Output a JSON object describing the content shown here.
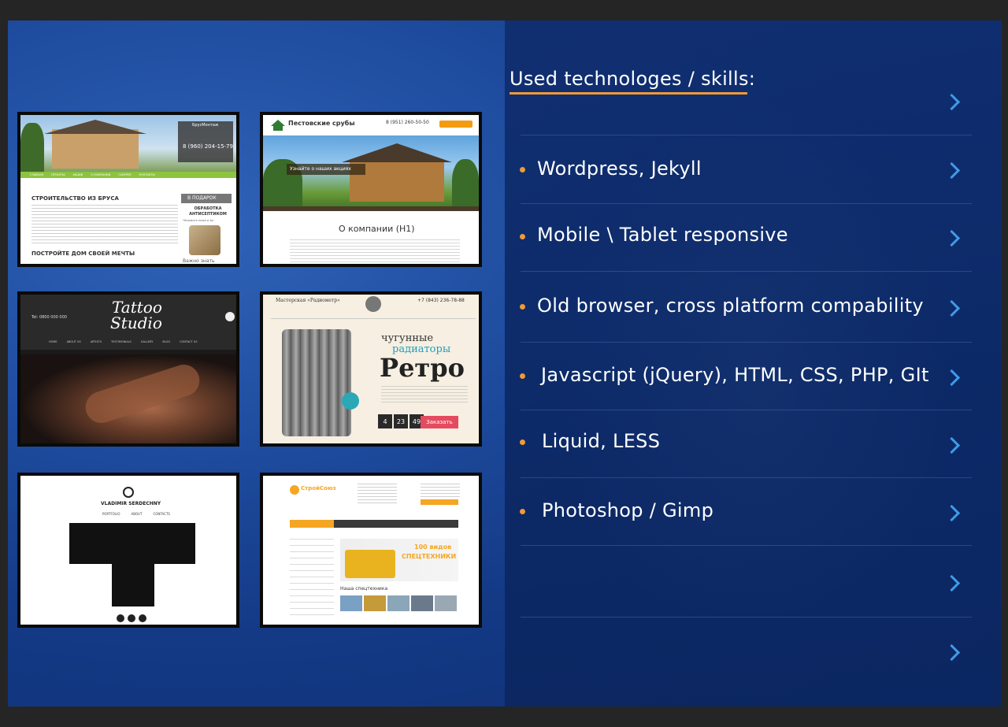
{
  "skills": {
    "title": "Used technologes / skills:",
    "items": [
      "Wordpress, Jekyll",
      "Mobile \\ Tablet responsive",
      "Old browser, cross platform compability",
      "Javascript (jQuery), HTML, CSS, PHP, GIt",
      "Liquid, LESS",
      "Photoshop / Gimp"
    ]
  },
  "thumbs": {
    "brus": {
      "phone": "8 (960) 204-15-79",
      "logo": "БрусМонтаж",
      "heading": "СТРОИТЕЛЬСТВО ИЗ БРУСА",
      "gift_title": "В ПОДАРОК",
      "gift_text": "ОБРАБОТКА АНТИСЕПТИКОМ",
      "gift_sub": "*Нажмите ниже и за!",
      "heading2": "ПОСТРОЙТЕ ДОМ СВОЕЙ МЕЧТЫ",
      "important": "Важно знать",
      "nav": [
        "ГЛАВНАЯ",
        "ПРОЕКТЫ",
        "АКЦИИ",
        "О КОМПАНИИ",
        "ГАЛЕРЕЯ",
        "КОНТАКТЫ"
      ]
    },
    "srub": {
      "logo": "Пестовские срубы",
      "phone": "8 (951) 260-50-50",
      "promo": "Узнайте о наших акциях",
      "heading": "О компании (H1)"
    },
    "tattoo": {
      "phone": "Tel: 0800 000 000",
      "logo1": "Tattoo",
      "logo2": "Studio",
      "nav": [
        "HOME",
        "ABOUT US",
        "ARTISTS",
        "TESTIMONIALS",
        "GALLERY",
        "BLOG",
        "CONTACT US"
      ]
    },
    "retro": {
      "brand": "Мастерская «Радиометр»",
      "phone": "+7 (843) 236-78-88",
      "word1": "чугунные",
      "word2": "радиаторы",
      "word3": "Ретро",
      "order": "Заказать",
      "c1": "4",
      "c2": "23",
      "c3": "49"
    },
    "vlad": {
      "name": "VLADIMIR SERDECHNY",
      "nav": [
        "PORTFOLIO",
        "ABOUT",
        "CONTACTS"
      ]
    },
    "stroy": {
      "logo": "СтройСоюз",
      "banner1": "100 видов",
      "banner2": "СПЕЦТЕХНИКИ",
      "section": "Наша спецтехника"
    }
  },
  "colors": {
    "accent": "#f19a36",
    "chevron": "#3f9be6"
  }
}
